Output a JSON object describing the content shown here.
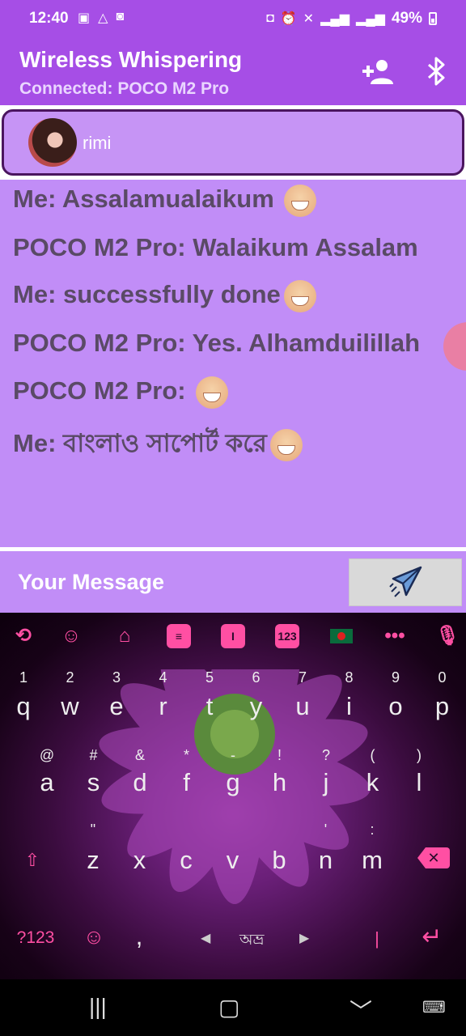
{
  "status_bar": {
    "time": "12:40",
    "battery": "49%"
  },
  "app": {
    "title": "Wireless Whispering",
    "subtitle": "Connected: POCO M2 Pro",
    "accent": "#a64ee6"
  },
  "contact": {
    "name": "rimi"
  },
  "chat": {
    "messages": [
      {
        "text": "Me: Assalamualaikum "
      },
      {
        "text": "POCO M2 Pro: Walaikum Assalam"
      },
      {
        "text": "Me: successfully done"
      },
      {
        "text": "POCO M2 Pro: Yes. Alhamduilillah"
      },
      {
        "text": "POCO M2 Pro: "
      },
      {
        "text": "Me: বাংলাও সাপোর্ট করে"
      }
    ]
  },
  "composer": {
    "placeholder": "Your Message"
  },
  "keyboard": {
    "row1": [
      "q",
      "w",
      "e",
      "r",
      "t",
      "y",
      "u",
      "i",
      "o",
      "p"
    ],
    "row1_hints": [
      "1",
      "2",
      "3",
      "4",
      "5",
      "6",
      "7",
      "8",
      "9",
      "0"
    ],
    "row2": [
      "a",
      "s",
      "d",
      "f",
      "g",
      "h",
      "j",
      "k",
      "l"
    ],
    "row2_hints": [
      "@",
      "#",
      "&",
      "*",
      "-",
      "!",
      "?",
      "(",
      ")"
    ],
    "row3": [
      "z",
      "x",
      "c",
      "v",
      "b",
      "n",
      "m"
    ],
    "row3_hints": [
      "\"",
      "",
      "",
      "",
      "",
      "'",
      ":",
      "/"
    ],
    "num_key": "?123",
    "comma": ",",
    "period": "|",
    "space_label": "অভ্র",
    "toolbar_num": "123"
  }
}
